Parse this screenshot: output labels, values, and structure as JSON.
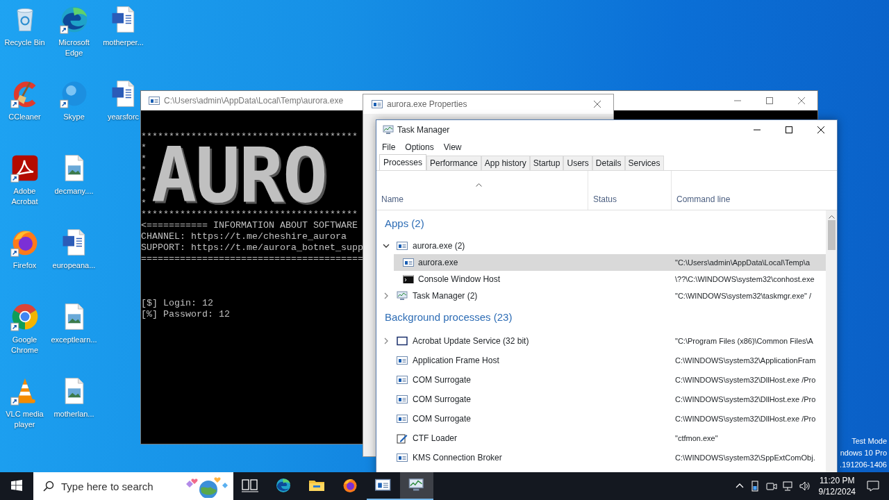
{
  "desktop": {
    "icons": [
      {
        "label": "Recycle Bin",
        "kind": "recycle",
        "shortcut": false
      },
      {
        "label": "CCleaner",
        "kind": "cleaner",
        "shortcut": true
      },
      {
        "label": "Adobe Acrobat",
        "kind": "pdf",
        "shortcut": true
      },
      {
        "label": "Firefox",
        "kind": "firefox",
        "shortcut": true
      },
      {
        "label": "Google Chrome",
        "kind": "chrome",
        "shortcut": true
      },
      {
        "label": "VLC media player",
        "kind": "vlc",
        "shortcut": true
      },
      {
        "label": "Microsoft Edge",
        "kind": "edge",
        "shortcut": true
      },
      {
        "label": "Skype",
        "kind": "skype",
        "shortcut": true
      },
      {
        "label": "decmany....",
        "kind": "image",
        "shortcut": false
      },
      {
        "label": "europeana...",
        "kind": "word",
        "shortcut": false
      },
      {
        "label": "exceptlearn...",
        "kind": "image",
        "shortcut": false
      },
      {
        "label": "motherlan...",
        "kind": "image",
        "shortcut": false
      },
      {
        "label": "motherper...",
        "kind": "word",
        "shortcut": false
      },
      {
        "label": "yearsforc",
        "kind": "word",
        "shortcut": false
      }
    ],
    "os_info": [
      "Test Mode",
      "ndows 10 Pro",
      ".191206-1406"
    ]
  },
  "console_window": {
    "title": "C:\\Users\\admin\\AppData\\Local\\Temp\\aurora.exe",
    "banner_top": "***************************************",
    "banner_side": [
      "*",
      "*",
      "*",
      "*",
      "*",
      "*"
    ],
    "banner_art": "AURO",
    "banner_bottom": "***************************************",
    "info_lines": [
      "<=========== INFORMATION ABOUT SOFTWARE",
      "CHANNEL: https://t.me/cheshire_aurora",
      "SUPPORT: https://t.me/aurora_botnet_supp",
      "========================================"
    ],
    "prompt_lines": [
      "[$] Login: 12",
      "[%] Password: 12"
    ]
  },
  "properties_window": {
    "title": "aurora.exe Properties"
  },
  "task_manager": {
    "title": "Task Manager",
    "menu": [
      "File",
      "Options",
      "View"
    ],
    "tabs": [
      {
        "label": "Processes",
        "selected": true
      },
      {
        "label": "Performance",
        "selected": false
      },
      {
        "label": "App history",
        "selected": false
      },
      {
        "label": "Startup",
        "selected": false
      },
      {
        "label": "Users",
        "selected": false
      },
      {
        "label": "Details",
        "selected": false
      },
      {
        "label": "Services",
        "selected": false
      }
    ],
    "columns": [
      "Name",
      "Status",
      "Command line"
    ],
    "groups": [
      {
        "title": "Apps (2)",
        "processes": [
          {
            "name": "aurora.exe (2)",
            "kind": "app",
            "expanded": true,
            "selected": false,
            "children": [
              {
                "name": "aurora.exe",
                "kind": "app",
                "selected": true,
                "command_line": "\"C:\\Users\\admin\\AppData\\Local\\Temp\\a"
              },
              {
                "name": "Console Window Host",
                "kind": "console",
                "selected": false,
                "command_line": "\\??\\C:\\WINDOWS\\system32\\conhost.exe"
              }
            ]
          },
          {
            "name": "Task Manager (2)",
            "kind": "taskmgr",
            "expanded": false,
            "selected": false,
            "command_line": "\"C:\\WINDOWS\\system32\\taskmgr.exe\" /"
          }
        ]
      },
      {
        "title": "Background processes (23)",
        "processes": [
          {
            "name": "Acrobat Update Service (32 bit)",
            "kind": "frame",
            "expanded": false,
            "selected": false,
            "command_line": "\"C:\\Program Files (x86)\\Common Files\\A"
          },
          {
            "name": "Application Frame Host",
            "kind": "app",
            "selected": false,
            "command_line": "C:\\WINDOWS\\system32\\ApplicationFram"
          },
          {
            "name": "COM Surrogate",
            "kind": "app",
            "selected": false,
            "command_line": "C:\\WINDOWS\\system32\\DllHost.exe /Pro"
          },
          {
            "name": "COM Surrogate",
            "kind": "app",
            "selected": false,
            "command_line": "C:\\WINDOWS\\system32\\DllHost.exe /Pro"
          },
          {
            "name": "COM Surrogate",
            "kind": "app",
            "selected": false,
            "command_line": "C:\\WINDOWS\\system32\\DllHost.exe /Pro"
          },
          {
            "name": "CTF Loader",
            "kind": "pen",
            "selected": false,
            "command_line": "\"ctfmon.exe\""
          },
          {
            "name": "KMS Connection Broker",
            "kind": "app",
            "selected": false,
            "command_line": "C:\\WINDOWS\\system32\\SppExtComObj."
          }
        ]
      }
    ]
  },
  "taskbar": {
    "search": {
      "placeholder": "Type here to search"
    },
    "apps": [
      {
        "kind": "taskview",
        "open": false,
        "selected": false
      },
      {
        "kind": "edge",
        "open": false,
        "selected": false
      },
      {
        "kind": "explorer",
        "open": false,
        "selected": false
      },
      {
        "kind": "firefox",
        "open": false,
        "selected": false
      },
      {
        "kind": "console",
        "open": true,
        "selected": false
      },
      {
        "kind": "taskmgr",
        "open": true,
        "selected": true
      }
    ],
    "clock": {
      "time": "11:20 PM",
      "date": "9/12/2024"
    }
  }
}
